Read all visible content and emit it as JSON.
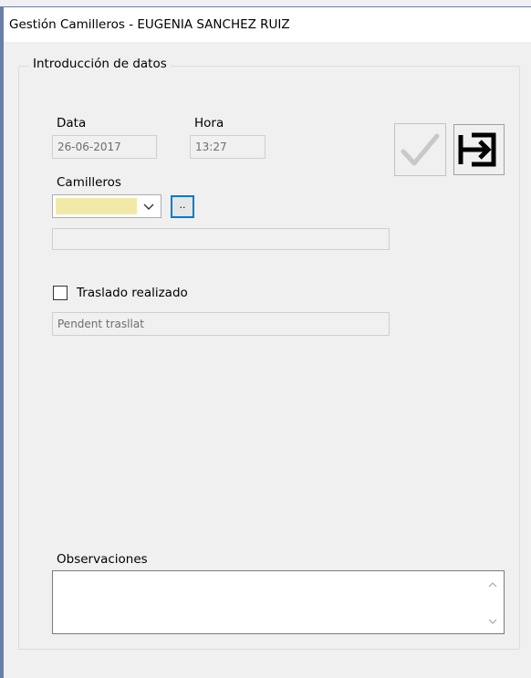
{
  "window": {
    "title": "Gestión Camilleros - EUGENIA SANCHEZ RUIZ"
  },
  "group": {
    "legend": "Introducción de datos"
  },
  "data_field": {
    "label": "Data",
    "value": "26-06-2017"
  },
  "hora_field": {
    "label": "Hora",
    "value": "13:27"
  },
  "camilleros": {
    "label": "Camilleros",
    "selected": "",
    "lookup_label": "..",
    "description": ""
  },
  "traslado": {
    "label": "Traslado realizado",
    "checked": false,
    "status": "Pendent trasllat"
  },
  "observaciones": {
    "label": "Observaciones",
    "value": ""
  },
  "icons": {
    "confirm": "check-icon",
    "exit": "exit-arrow-icon"
  },
  "colors": {
    "window_border": "#6a7fa8",
    "combo_highlight": "#f2e9a8",
    "focus_blue": "#0078d7"
  }
}
